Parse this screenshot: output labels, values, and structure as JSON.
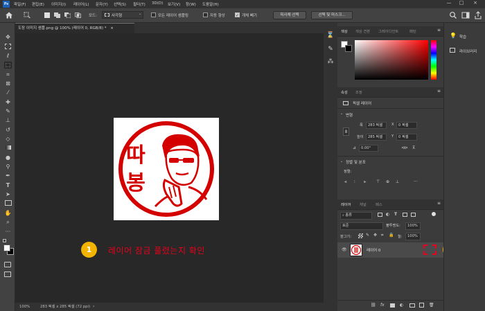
{
  "menu": [
    "파일(F)",
    "편집(E)",
    "이미지(I)",
    "레이어(L)",
    "문자(Y)",
    "선택(S)",
    "필터(T)",
    "3D(D)",
    "보기(V)",
    "창(W)",
    "도움말(H)"
  ],
  "options": {
    "mode_label": "모드:",
    "mode_value": "사각형",
    "sample_all_layers": "모든 레이어 샘플링",
    "auto_enhance": "자동 향상",
    "auto_enhance_checked": false,
    "object_subtract": "개체 빼기",
    "object_subtract_checked": true,
    "select_subject": "피사체 선택",
    "select_and_mask": "선택 및 마스크..."
  },
  "document": {
    "tab_title": "도장 이미지 샘플.png @ 100% (레이어 0, RGB/8) *",
    "close": "×",
    "zoom": "100%",
    "info": "283 픽셀 x 285 픽셀 (72 ppi)"
  },
  "stamp": {
    "chars": [
      "따",
      "봉"
    ],
    "color": "#d40000"
  },
  "annotation": {
    "number": "1",
    "text": "레이어 잠금 풀렸는지 확인",
    "badge_color": "#f2b400",
    "highlight_color": "#e8001c"
  },
  "color_panel": {
    "tabs": [
      "색상",
      "색상 견본",
      "그레이디언트",
      "패턴"
    ],
    "active": 0
  },
  "properties_panel": {
    "tabs": [
      "속성",
      "조정"
    ],
    "active": 0,
    "layer_type": "픽셀 레이어",
    "transform_title": "변형",
    "w_label": "폭",
    "w_value": "283 픽셀",
    "h_label": "높이",
    "h_value": "285 픽셀",
    "x_label": "X",
    "x_value": "0 픽셀",
    "y_label": "Y",
    "y_value": "0 픽셀",
    "angle_value": "0.00°",
    "align_title": "정렬 및 분포",
    "align_label": "정렬:"
  },
  "layers_panel": {
    "tabs": [
      "레이어",
      "채널",
      "패스"
    ],
    "active": 0,
    "filter_value": "종류",
    "blend_mode": "표준",
    "opacity_label": "불투명도:",
    "opacity_value": "100%",
    "lock_label": "잠그기:",
    "fill_label": "칠:",
    "fill_value": "100%",
    "layer_name": "레이어 0"
  },
  "far_panel": {
    "items": [
      "학습",
      "라이브러리"
    ]
  }
}
